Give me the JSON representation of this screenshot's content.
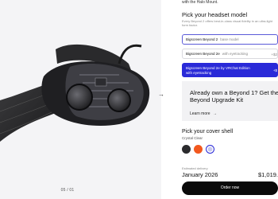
{
  "page": {
    "top_note": "with the Halo Mount.",
    "slide_counter": "05 / 01",
    "next_arrow": "→"
  },
  "headset": {
    "heading": "Pick your headset model",
    "subtitle": "Every Beyond 2 offers best-in-class visual fidelity in an ultra-light form factor.",
    "options": [
      {
        "name": "Bigscreen Beyond 2",
        "tag": "base model",
        "price": "",
        "selected": true
      },
      {
        "name": "Bigscreen Beyond 2e",
        "tag": "with eyetracking",
        "price": "+$2",
        "selected": false
      },
      {
        "name": "Bigscreen Beyond 2e by VRChat Edition",
        "tag": "with eyetracking",
        "price": "+$",
        "selected": false
      }
    ]
  },
  "upgrade": {
    "text": "Already own a Beyond 1? Get the Beyond Upgrade Kit",
    "link": "Learn more",
    "link_icon": "→"
  },
  "cover": {
    "heading": "Pick your cover shell",
    "variant": "Crystal Clear",
    "swatches": [
      {
        "name": "black",
        "color": "#2b2b2d",
        "selected": false
      },
      {
        "name": "orange",
        "color": "#f2581e",
        "selected": false
      },
      {
        "name": "crystal-clear",
        "color": "#c9c9ec",
        "selected": true
      }
    ]
  },
  "summary": {
    "delivery_label": "Estimated delivery",
    "delivery_date": "January 2026",
    "total": "$1,019.",
    "order_button": "Order now"
  },
  "colors": {
    "accent": "#2a2ad8",
    "button": "#0a0a0a"
  }
}
